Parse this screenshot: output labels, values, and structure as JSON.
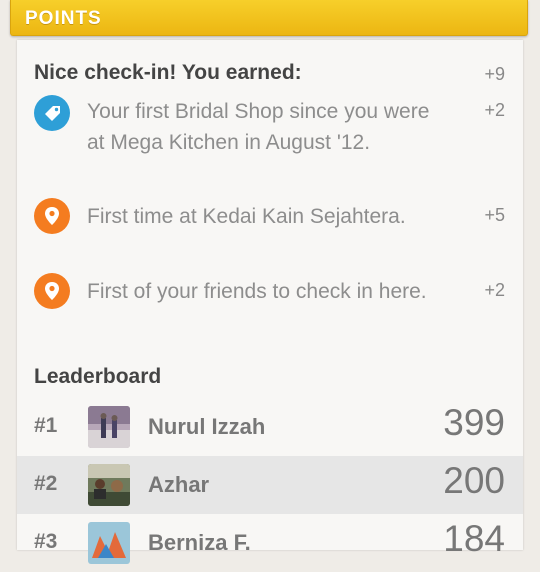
{
  "header": {
    "title": "POINTS"
  },
  "points": {
    "title": "Nice check-in! You earned:",
    "total": "+9",
    "reasons": [
      {
        "icon": "price-tag-icon",
        "text": "Your first Bridal Shop since you were at Mega Kitchen in August '12.",
        "points": "+2"
      },
      {
        "icon": "location-pin-icon",
        "text": "First time at Kedai Kain Sejahtera.",
        "points": "+5"
      },
      {
        "icon": "location-pin-icon",
        "text": "First of your friends to check in here.",
        "points": "+2"
      }
    ]
  },
  "leaderboard": {
    "title": "Leaderboard",
    "entries": [
      {
        "rank": "#1",
        "name": "Nurul Izzah",
        "score": "399",
        "highlighted": false
      },
      {
        "rank": "#2",
        "name": "Azhar",
        "score": "200",
        "highlighted": true
      },
      {
        "rank": "#3",
        "name": "Berniza F.",
        "score": "184",
        "highlighted": false
      }
    ]
  },
  "colors": {
    "header_yellow": "#f2c21d",
    "tag_blue": "#2e9fd7",
    "pin_orange": "#f47c20",
    "highlight_row": "#e6e6e6"
  }
}
